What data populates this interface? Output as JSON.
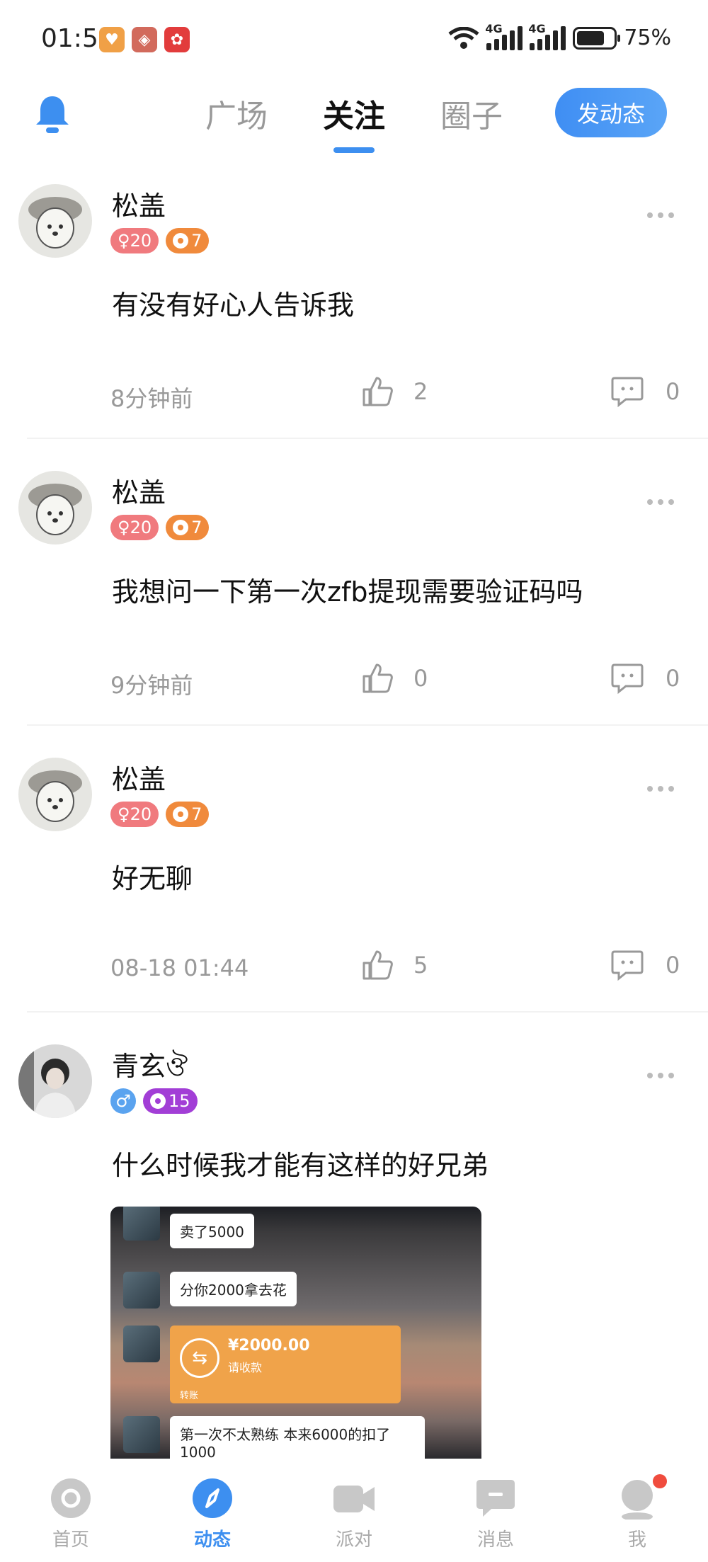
{
  "status_bar": {
    "time": "01:56",
    "network_1": "4G",
    "network_2": "4G",
    "battery": "75%"
  },
  "header": {
    "tabs": [
      {
        "label": "广场"
      },
      {
        "label": "关注"
      },
      {
        "label": "圈子"
      }
    ],
    "post_button": "发动态"
  },
  "posts": [
    {
      "username": "松盖",
      "gender_age": "♀20",
      "level": "7",
      "text": "有没有好心人告诉我",
      "time": "8分钟前",
      "likes": "2",
      "comments": "0"
    },
    {
      "username": "松盖",
      "gender_age": "♀20",
      "level": "7",
      "text": "我想问一下第一次zfb提现需要验证码吗",
      "time": "9分钟前",
      "likes": "0",
      "comments": "0"
    },
    {
      "username": "松盖",
      "gender_age": "♀20",
      "level": "7",
      "text": "好无聊",
      "time": "08-18 01:44",
      "likes": "5",
      "comments": "0"
    },
    {
      "username": "青玄ঔ",
      "gender_age": "♂",
      "level": "15",
      "text": "什么时候我才能有这样的好兄弟",
      "image_chat": {
        "msg1": "卖了5000",
        "msg2": "分你2000拿去花",
        "transfer_amount": "¥2000.00",
        "transfer_status": "请收款",
        "transfer_label": "转账",
        "msg3": "第一次不太熟练 本来6000的扣了1000"
      }
    }
  ],
  "bottom_nav": [
    {
      "label": "首页"
    },
    {
      "label": "动态"
    },
    {
      "label": "派对"
    },
    {
      "label": "消息"
    },
    {
      "label": "我"
    }
  ],
  "colors": {
    "accent": "#3d8ff0",
    "female_badge": "#f07a7e",
    "level_badge": "#f08a3c",
    "purple_badge": "#a23ed6",
    "notify_dot": "#f04c3e"
  }
}
